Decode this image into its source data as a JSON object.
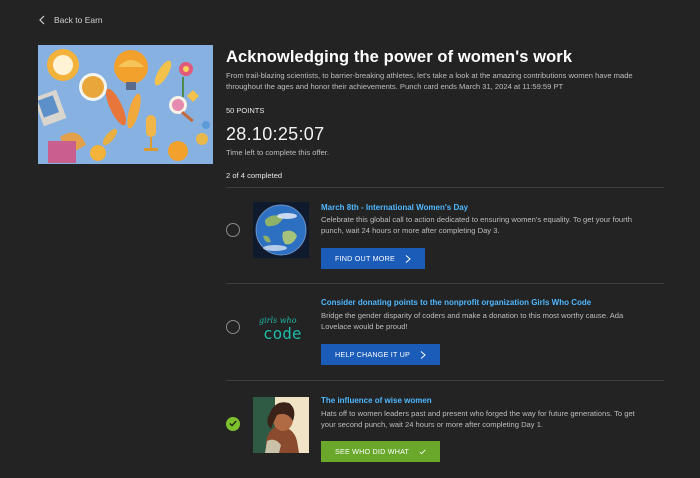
{
  "nav": {
    "back_label": "Back to Earn"
  },
  "offer": {
    "title": "Acknowledging the power of women's work",
    "description": "From trail-blazing scientists, to barrier-breaking athletes, let's take a look at the amazing contributions women have made throughout the ages and honor their achievements. Punch card ends March 31, 2024 at 11:59:59 PT",
    "points": "50 POINTS",
    "timer": "28.10:25:07",
    "timer_label": "Time left to complete this offer.",
    "progress": "2 of 4 completed"
  },
  "items": [
    {
      "title": "March 8th - International Women's Day",
      "description": "Celebrate this global call to action dedicated to ensuring women's equality. To get your fourth punch, wait 24 hours or more after completing Day 3.",
      "button": "FIND OUT MORE",
      "completed": false,
      "thumb_icon": "earth-icon"
    },
    {
      "title": "Consider donating points to the nonprofit organization Girls Who Code",
      "description": "Bridge the gender disparity of coders and make a donation to this most worthy cause. Ada Lovelace would be proud!",
      "button": "HELP CHANGE IT UP",
      "completed": false,
      "thumb_icon": "girls-who-code-logo",
      "logo_text_top": "girls who",
      "logo_text_main": "code"
    },
    {
      "title": "The influence of wise women",
      "description": "Hats off to women leaders past and present who forged the way for future generations. To get your second punch, wait 24 hours or more after completing Day 1.",
      "button": "SEE WHO DID WHAT",
      "completed": true,
      "thumb_icon": "woman-portrait-icon"
    }
  ],
  "colors": {
    "background": "#232323",
    "link_blue": "#4fb7ff",
    "button_blue": "#1a5cb8",
    "button_green": "#6aa82c",
    "check_green": "#7ec12f"
  }
}
